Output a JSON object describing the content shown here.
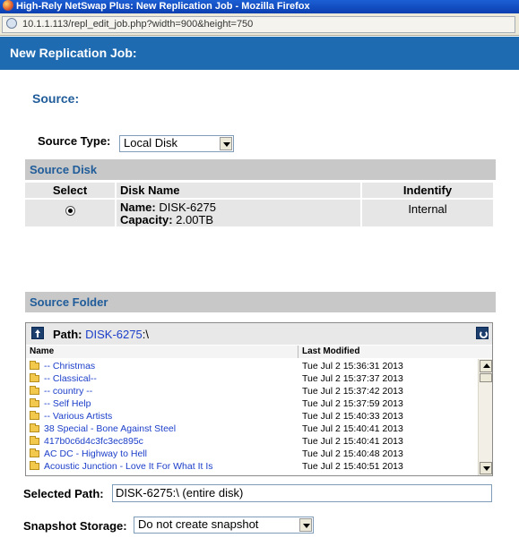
{
  "window": {
    "title": "High-Rely NetSwap Plus: New Replication Job - Mozilla Firefox",
    "url": "10.1.1.113/repl_edit_job.php?width=900&height=750"
  },
  "page": {
    "header": "New Replication Job:",
    "source_heading": "Source:"
  },
  "source_type": {
    "label": "Source Type:",
    "value": "Local Disk"
  },
  "source_disk": {
    "section_title": "Source Disk",
    "columns": [
      "Select",
      "Disk Name",
      "Indentify"
    ],
    "rows": [
      {
        "selected": true,
        "name_label": "Name:",
        "name_value": "DISK-6275",
        "capacity_label": "Capacity:",
        "capacity_value": "2.00TB",
        "identify": "Internal"
      }
    ]
  },
  "source_folder": {
    "section_title": "Source Folder",
    "path_label": "Path:",
    "path_link": "DISK-6275",
    "path_suffix": ":\\",
    "columns": {
      "name": "Name",
      "modified": "Last Modified"
    },
    "files": [
      {
        "name": "-- Christmas",
        "modified": "Tue Jul 2 15:36:31 2013"
      },
      {
        "name": "-- Classical--",
        "modified": "Tue Jul 2 15:37:37 2013"
      },
      {
        "name": "-- country --",
        "modified": "Tue Jul 2 15:37:42 2013"
      },
      {
        "name": "-- Self Help",
        "modified": "Tue Jul 2 15:37:59 2013"
      },
      {
        "name": "-- Various Artists",
        "modified": "Tue Jul 2 15:40:33 2013"
      },
      {
        "name": "38 Special - Bone Against Steel",
        "modified": "Tue Jul 2 15:40:41 2013"
      },
      {
        "name": "417b0c6d4c3fc3ec895c",
        "modified": "Tue Jul 2 15:40:41 2013"
      },
      {
        "name": "AC DC - Highway to Hell",
        "modified": "Tue Jul 2 15:40:48 2013"
      },
      {
        "name": "Acoustic Junction - Love It For What It Is",
        "modified": "Tue Jul 2 15:40:51 2013"
      }
    ]
  },
  "selected_path": {
    "label": "Selected Path:",
    "value": "DISK-6275:\\ (entire disk)"
  },
  "snapshot": {
    "label": "Snapshot Storage:",
    "value": "Do not create snapshot"
  },
  "icons": {
    "up": "folder-up-icon",
    "refresh": "refresh-icon",
    "folder": "folder-icon"
  }
}
